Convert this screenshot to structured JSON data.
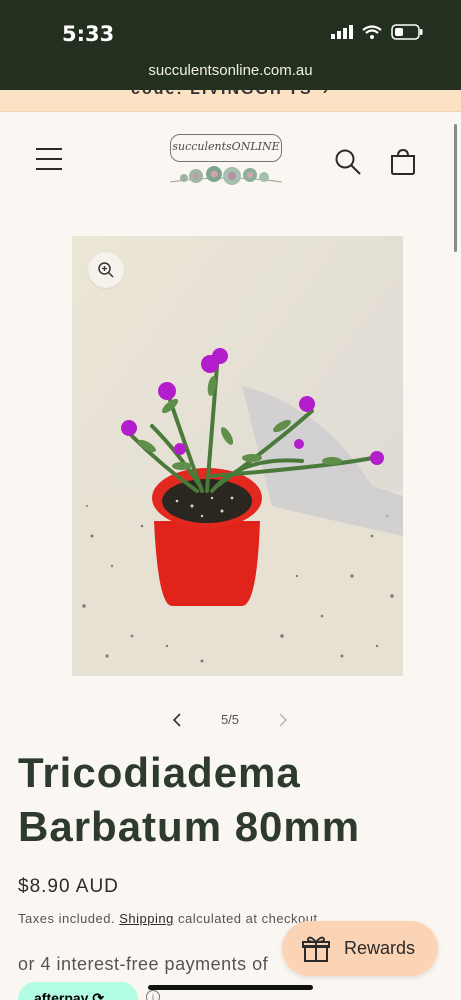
{
  "status_bar": {
    "time": "5:33",
    "url": "succulentsonline.com.au"
  },
  "announcement": {
    "text": "code: LIVINGGIFTS",
    "arrow": "›"
  },
  "header": {
    "logo_text": "succulentsONLINE"
  },
  "gallery": {
    "counter": "5/5"
  },
  "product": {
    "title": "Tricodiadema Barbatum 80mm",
    "price": "$8.90 AUD",
    "tax_prefix": "Taxes included.",
    "shipping_link": "Shipping",
    "tax_suffix": "calculated at checkout.",
    "payments_text": "or 4 interest-free payments of",
    "afterpay_label": "afterpay ⟳"
  },
  "rewards": {
    "label": "Rewards"
  },
  "colors": {
    "status_bg": "#23301f",
    "announce_bg": "#fbe2c4",
    "rewards_bg": "#fbd3b5",
    "afterpay_bg": "#b2fce4",
    "title_color": "#2e3a2d"
  },
  "icons": [
    "menu-icon",
    "search-icon",
    "cart-icon",
    "zoom-icon",
    "chevron-left-icon",
    "chevron-right-icon",
    "gift-icon",
    "info-icon"
  ]
}
